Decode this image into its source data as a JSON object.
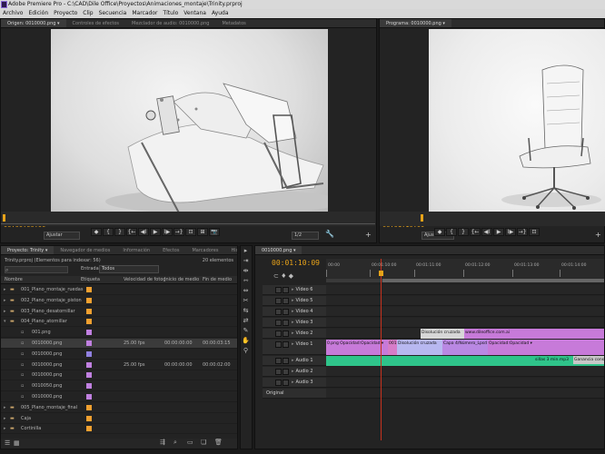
{
  "app": {
    "title": "Adobe Premiere Pro - C:\\CAD\\Dile Office\\Proyectos\\Animaciones_montaje\\Trinity.prproj"
  },
  "menu": [
    "Archivo",
    "Edición",
    "Proyecto",
    "Clip",
    "Secuencia",
    "Marcador",
    "Título",
    "Ventana",
    "Ayuda"
  ],
  "source_monitor": {
    "tabs": [
      "Origen: 0010000.png ▾",
      "Controles de efectos",
      "Mezclador de audio: 0010000.png",
      "Metadatos"
    ],
    "timecode_in": "00:00:00:00",
    "timecode_duration": "00:00:03:16",
    "fit_label": "Ajustar",
    "resolution_label": "1/2"
  },
  "program_monitor": {
    "tabs": [
      "Programa: 0010000.png ▾"
    ],
    "timecode": "00:01:10:09",
    "fit_label": "Ajustar"
  },
  "transport": [
    "◆",
    "{",
    "}",
    "{←",
    "◀I",
    "▶",
    "I▶",
    "→}",
    "⊡",
    "⊞",
    "📷"
  ],
  "project": {
    "tabs": [
      "Proyecto: Trinity ▾",
      "Navegador de medios",
      "Información",
      "Efectos",
      "Marcadores",
      "Historial"
    ],
    "name": "Trinity.prproj (Elementos para indexar: 56)",
    "count": "20 elementos",
    "entry_label": "Entrada:",
    "entry_value": "Todos",
    "columns": [
      "Nombre",
      "Etiqueta",
      "Velocidad de fotog",
      "Inicio de medio",
      "Fin de medio"
    ],
    "items": [
      {
        "name": "001_Plano_montaje_ruedas",
        "type": "folder",
        "depth": 0,
        "expanded": false,
        "color": "#f0a030"
      },
      {
        "name": "002_Plano_montaje_piston",
        "type": "folder",
        "depth": 0,
        "expanded": false,
        "color": "#f0a030"
      },
      {
        "name": "003_Plano_desatornillar",
        "type": "folder",
        "depth": 0,
        "expanded": false,
        "color": "#f0a030"
      },
      {
        "name": "004_Plano_atornillar",
        "type": "folder",
        "depth": 0,
        "expanded": true,
        "color": "#f0a030"
      },
      {
        "name": "001.png",
        "type": "file",
        "depth": 1,
        "color": "#c080e0"
      },
      {
        "name": "0010000.png",
        "type": "file",
        "depth": 1,
        "color": "#c080e0",
        "fps": "25.00 fps",
        "start": "00:00:00:00",
        "end": "00:00:03:15",
        "selected": true
      },
      {
        "name": "0010000.png",
        "type": "file",
        "depth": 1,
        "color": "#9080e0"
      },
      {
        "name": "0010000.png",
        "type": "file",
        "depth": 1,
        "color": "#c080e0",
        "fps": "25.00 fps",
        "start": "00:00:00:00",
        "end": "00:00:02:00"
      },
      {
        "name": "0010000.png",
        "type": "file",
        "depth": 1,
        "color": "#c080e0"
      },
      {
        "name": "0010050.png",
        "type": "file",
        "depth": 1,
        "color": "#c080e0"
      },
      {
        "name": "0010000.png",
        "type": "file",
        "depth": 1,
        "color": "#c080e0"
      },
      {
        "name": "005_Plano_montaje_final",
        "type": "folder",
        "depth": 0,
        "expanded": false,
        "color": "#f0a030"
      },
      {
        "name": "Caja",
        "type": "folder",
        "depth": 0,
        "expanded": false,
        "color": "#f0a030"
      },
      {
        "name": "Cortinilla",
        "type": "folder",
        "depth": 0,
        "expanded": false,
        "color": "#f0a030"
      }
    ]
  },
  "timeline": {
    "tab": "0010000.png ▾",
    "timecode": "00:01:10:09",
    "ruler": [
      "00:00",
      "00:01:10:00",
      "00:01:11:00",
      "00:01:12:00",
      "00:01:13:00",
      "00:01:14:00"
    ],
    "tracks": [
      {
        "name": "Vídeo 6",
        "kind": "video"
      },
      {
        "name": "Vídeo 5",
        "kind": "video"
      },
      {
        "name": "Vídeo 4",
        "kind": "video"
      },
      {
        "name": "Vídeo 3",
        "kind": "video"
      },
      {
        "name": "Vídeo 2",
        "kind": "video"
      },
      {
        "name": "Vídeo 1",
        "kind": "video",
        "expanded": true
      },
      {
        "name": "Audio 1",
        "kind": "audio"
      },
      {
        "name": "Audio 2",
        "kind": "audio"
      },
      {
        "name": "Audio 3",
        "kind": "audio"
      },
      {
        "name": "Original",
        "kind": "master"
      }
    ],
    "clips": {
      "v2_transition": "Disolución cruzada",
      "v2_web": "www.dileoffice.com.ai",
      "v1_a": "0.png Opacidad:Opacidad ▾",
      "v1_b": "001",
      "v1_transition": "Disolución cruzada",
      "v1_c": "Capa 4/Número_Lpsd",
      "v1_d": "Opacidad:Opacidad ▾",
      "a1_clip": "sillas 3 min.mp3",
      "a1_effect": "Ganancia const"
    }
  },
  "colors": {
    "accent_timecode": "#e8a319",
    "video_clip": "#c77ad9",
    "audio_clip": "#2fc48a",
    "transition": "#b8b8f0"
  }
}
